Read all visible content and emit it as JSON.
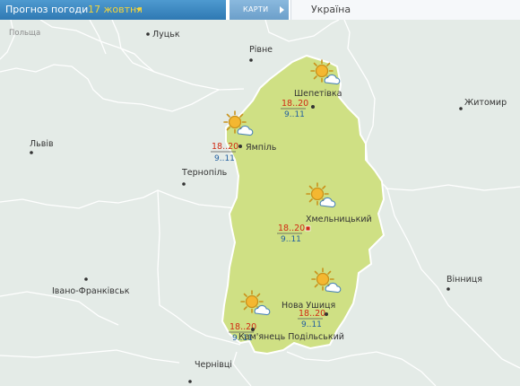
{
  "header": {
    "title": "Прогноз погоди",
    "date": "17 жовтня",
    "maps_button": "КАРТИ",
    "region": "Україна"
  },
  "map": {
    "region_color": "#cfe084",
    "border_color": "#ffffff",
    "background_color": "#e4ebe7",
    "neighbor_labels": {
      "poland": "Польща",
      "lutsk": "Луцьк",
      "rivne": "Рівне",
      "zhytomyr": "Житомир",
      "lviv": "Львів",
      "ternopil": "Тернопіль",
      "ivano_frankivsk": "Івано-Франківськ",
      "vinnytsia": "Вінниця",
      "chernivtsi": "Чернівці"
    },
    "forecast": [
      {
        "id": "shepetivka",
        "city": "Шепетівка",
        "day_temp": "18..20",
        "night_temp": "9..11",
        "icon": "sun-cloud-icon"
      },
      {
        "id": "yampil",
        "city": "Ямпіль",
        "day_temp": "18..20",
        "night_temp": "9..11",
        "icon": "sun-cloud-icon"
      },
      {
        "id": "khmelnytskyi",
        "city": "Хмельницький",
        "day_temp": "18..20",
        "night_temp": "9..11",
        "icon": "sun-cloud-icon"
      },
      {
        "id": "nova_ushytsia",
        "city": "Нова Ушиця",
        "day_temp": "18..20",
        "night_temp": "9..11",
        "icon": "sun-cloud-icon"
      },
      {
        "id": "kamianets",
        "city": "Кам'янець Подільський",
        "day_temp": "18..20",
        "night_temp": "9..11",
        "icon": "sun-cloud-icon"
      }
    ]
  }
}
